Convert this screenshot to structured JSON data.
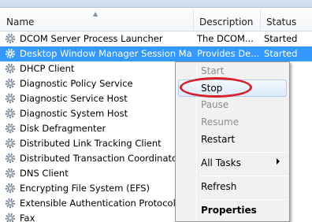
{
  "columns": {
    "name": "Name",
    "description": "Description",
    "status": "Status"
  },
  "services": [
    {
      "name": "DCOM Server Process Launcher",
      "description": "The DCOM...",
      "status": "Started"
    },
    {
      "name": "Desktop Window Manager Session Ma...",
      "description": "Provides De...",
      "status": "Started"
    },
    {
      "name": "DHCP Client",
      "description": "",
      "status": ""
    },
    {
      "name": "Diagnostic Policy Service",
      "description": "",
      "status": ""
    },
    {
      "name": "Diagnostic Service Host",
      "description": "",
      "status": ""
    },
    {
      "name": "Diagnostic System Host",
      "description": "",
      "status": ""
    },
    {
      "name": "Disk Defragmenter",
      "description": "",
      "status": ""
    },
    {
      "name": "Distributed Link Tracking Client",
      "description": "",
      "status": ""
    },
    {
      "name": "Distributed Transaction Coordinator",
      "description": "",
      "status": ""
    },
    {
      "name": "DNS Client",
      "description": "",
      "status": ""
    },
    {
      "name": "Encrypting File System (EFS)",
      "description": "",
      "status": ""
    },
    {
      "name": "Extensible Authentication Protocol",
      "description": "",
      "status": ""
    },
    {
      "name": "Fax",
      "description": "",
      "status": ""
    }
  ],
  "context_menu": {
    "start": "Start",
    "stop": "Stop",
    "pause": "Pause",
    "resume": "Resume",
    "restart": "Restart",
    "all_tasks": "All Tasks",
    "refresh": "Refresh",
    "properties": "Properties"
  },
  "colors": {
    "selection": "#3399ff",
    "annotation": "#d8202a",
    "menu_bg": "#f1f1f1"
  },
  "icons": {
    "service": "gear-icon",
    "sort": "sort-ascending-icon",
    "submenu": "chevron-right-icon"
  }
}
